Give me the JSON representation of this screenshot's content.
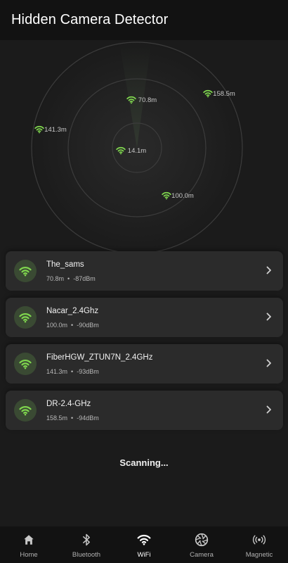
{
  "app": {
    "title": "Hidden Camera Detector"
  },
  "colors": {
    "accent": "#7fd64e",
    "background": "#1b1b1b",
    "card": "#2b2b2b",
    "bar": "#121212"
  },
  "radar": {
    "nodes": [
      {
        "label": "70.8m"
      },
      {
        "label": "158.5m"
      },
      {
        "label": "141.3m"
      },
      {
        "label": "14.1m"
      },
      {
        "label": "100.0m"
      }
    ]
  },
  "networks": [
    {
      "ssid": "The_sams",
      "distance": "70.8m",
      "signal": "-87dBm",
      "icon": "wifi-icon"
    },
    {
      "ssid": "Nacar_2.4Ghz",
      "distance": "100.0m",
      "signal": "-90dBm",
      "icon": "wifi-icon"
    },
    {
      "ssid": "FiberHGW_ZTUN7N_2.4GHz",
      "distance": "141.3m",
      "signal": "-93dBm",
      "icon": "wifi-icon"
    },
    {
      "ssid": "DR-2.4-GHz",
      "distance": "158.5m",
      "signal": "-94dBm",
      "icon": "wifi-icon"
    }
  ],
  "meta_separator": "•",
  "status": "Scanning...",
  "nav": {
    "items": [
      {
        "label": "Home",
        "icon": "home-icon"
      },
      {
        "label": "Bluetooth",
        "icon": "bluetooth-icon"
      },
      {
        "label": "WiFi",
        "icon": "wifi-icon"
      },
      {
        "label": "Camera",
        "icon": "camera-shutter-icon"
      },
      {
        "label": "Magnetic",
        "icon": "magnetic-signal-icon"
      }
    ],
    "active": "WiFi"
  }
}
